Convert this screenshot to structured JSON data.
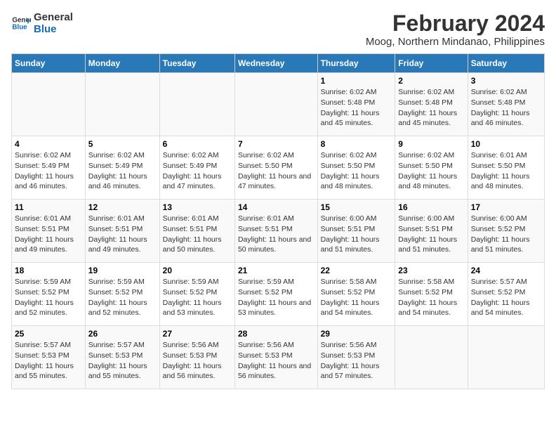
{
  "logo": {
    "text_general": "General",
    "text_blue": "Blue"
  },
  "title": "February 2024",
  "subtitle": "Moog, Northern Mindanao, Philippines",
  "days_of_week": [
    "Sunday",
    "Monday",
    "Tuesday",
    "Wednesday",
    "Thursday",
    "Friday",
    "Saturday"
  ],
  "weeks": [
    [
      {
        "day": "",
        "detail": ""
      },
      {
        "day": "",
        "detail": ""
      },
      {
        "day": "",
        "detail": ""
      },
      {
        "day": "",
        "detail": ""
      },
      {
        "day": "1",
        "detail": "Sunrise: 6:02 AM\nSunset: 5:48 PM\nDaylight: 11 hours and 45 minutes."
      },
      {
        "day": "2",
        "detail": "Sunrise: 6:02 AM\nSunset: 5:48 PM\nDaylight: 11 hours and 45 minutes."
      },
      {
        "day": "3",
        "detail": "Sunrise: 6:02 AM\nSunset: 5:48 PM\nDaylight: 11 hours and 46 minutes."
      }
    ],
    [
      {
        "day": "4",
        "detail": "Sunrise: 6:02 AM\nSunset: 5:49 PM\nDaylight: 11 hours and 46 minutes."
      },
      {
        "day": "5",
        "detail": "Sunrise: 6:02 AM\nSunset: 5:49 PM\nDaylight: 11 hours and 46 minutes."
      },
      {
        "day": "6",
        "detail": "Sunrise: 6:02 AM\nSunset: 5:49 PM\nDaylight: 11 hours and 47 minutes."
      },
      {
        "day": "7",
        "detail": "Sunrise: 6:02 AM\nSunset: 5:50 PM\nDaylight: 11 hours and 47 minutes."
      },
      {
        "day": "8",
        "detail": "Sunrise: 6:02 AM\nSunset: 5:50 PM\nDaylight: 11 hours and 48 minutes."
      },
      {
        "day": "9",
        "detail": "Sunrise: 6:02 AM\nSunset: 5:50 PM\nDaylight: 11 hours and 48 minutes."
      },
      {
        "day": "10",
        "detail": "Sunrise: 6:01 AM\nSunset: 5:50 PM\nDaylight: 11 hours and 48 minutes."
      }
    ],
    [
      {
        "day": "11",
        "detail": "Sunrise: 6:01 AM\nSunset: 5:51 PM\nDaylight: 11 hours and 49 minutes."
      },
      {
        "day": "12",
        "detail": "Sunrise: 6:01 AM\nSunset: 5:51 PM\nDaylight: 11 hours and 49 minutes."
      },
      {
        "day": "13",
        "detail": "Sunrise: 6:01 AM\nSunset: 5:51 PM\nDaylight: 11 hours and 50 minutes."
      },
      {
        "day": "14",
        "detail": "Sunrise: 6:01 AM\nSunset: 5:51 PM\nDaylight: 11 hours and 50 minutes."
      },
      {
        "day": "15",
        "detail": "Sunrise: 6:00 AM\nSunset: 5:51 PM\nDaylight: 11 hours and 51 minutes."
      },
      {
        "day": "16",
        "detail": "Sunrise: 6:00 AM\nSunset: 5:51 PM\nDaylight: 11 hours and 51 minutes."
      },
      {
        "day": "17",
        "detail": "Sunrise: 6:00 AM\nSunset: 5:52 PM\nDaylight: 11 hours and 51 minutes."
      }
    ],
    [
      {
        "day": "18",
        "detail": "Sunrise: 5:59 AM\nSunset: 5:52 PM\nDaylight: 11 hours and 52 minutes."
      },
      {
        "day": "19",
        "detail": "Sunrise: 5:59 AM\nSunset: 5:52 PM\nDaylight: 11 hours and 52 minutes."
      },
      {
        "day": "20",
        "detail": "Sunrise: 5:59 AM\nSunset: 5:52 PM\nDaylight: 11 hours and 53 minutes."
      },
      {
        "day": "21",
        "detail": "Sunrise: 5:59 AM\nSunset: 5:52 PM\nDaylight: 11 hours and 53 minutes."
      },
      {
        "day": "22",
        "detail": "Sunrise: 5:58 AM\nSunset: 5:52 PM\nDaylight: 11 hours and 54 minutes."
      },
      {
        "day": "23",
        "detail": "Sunrise: 5:58 AM\nSunset: 5:52 PM\nDaylight: 11 hours and 54 minutes."
      },
      {
        "day": "24",
        "detail": "Sunrise: 5:57 AM\nSunset: 5:52 PM\nDaylight: 11 hours and 54 minutes."
      }
    ],
    [
      {
        "day": "25",
        "detail": "Sunrise: 5:57 AM\nSunset: 5:53 PM\nDaylight: 11 hours and 55 minutes."
      },
      {
        "day": "26",
        "detail": "Sunrise: 5:57 AM\nSunset: 5:53 PM\nDaylight: 11 hours and 55 minutes."
      },
      {
        "day": "27",
        "detail": "Sunrise: 5:56 AM\nSunset: 5:53 PM\nDaylight: 11 hours and 56 minutes."
      },
      {
        "day": "28",
        "detail": "Sunrise: 5:56 AM\nSunset: 5:53 PM\nDaylight: 11 hours and 56 minutes."
      },
      {
        "day": "29",
        "detail": "Sunrise: 5:56 AM\nSunset: 5:53 PM\nDaylight: 11 hours and 57 minutes."
      },
      {
        "day": "",
        "detail": ""
      },
      {
        "day": "",
        "detail": ""
      }
    ]
  ]
}
